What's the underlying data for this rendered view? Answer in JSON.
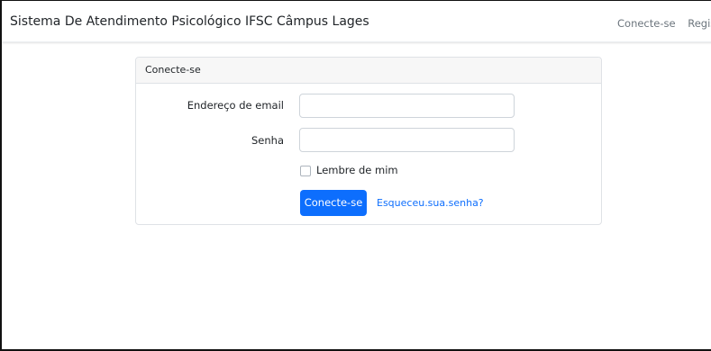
{
  "navbar": {
    "brand": "Sistema De Atendimento Psicológico IFSC Câmpus Lages",
    "links": [
      "Conecte-se",
      "Registre-se"
    ]
  },
  "login_card": {
    "header": "Conecte-se",
    "email_label": "Endereço de email",
    "email_value": "",
    "password_label": "Senha",
    "password_value": "",
    "remember_label": "Lembre de mim",
    "remember_checked": false,
    "submit_label": "Conecte-se",
    "forgot_link": "Esqueceu.sua.senha?"
  },
  "colors": {
    "primary": "#0d6efd",
    "card_header_bg": "#f7f7f7",
    "nav_link": "#6c757d"
  }
}
